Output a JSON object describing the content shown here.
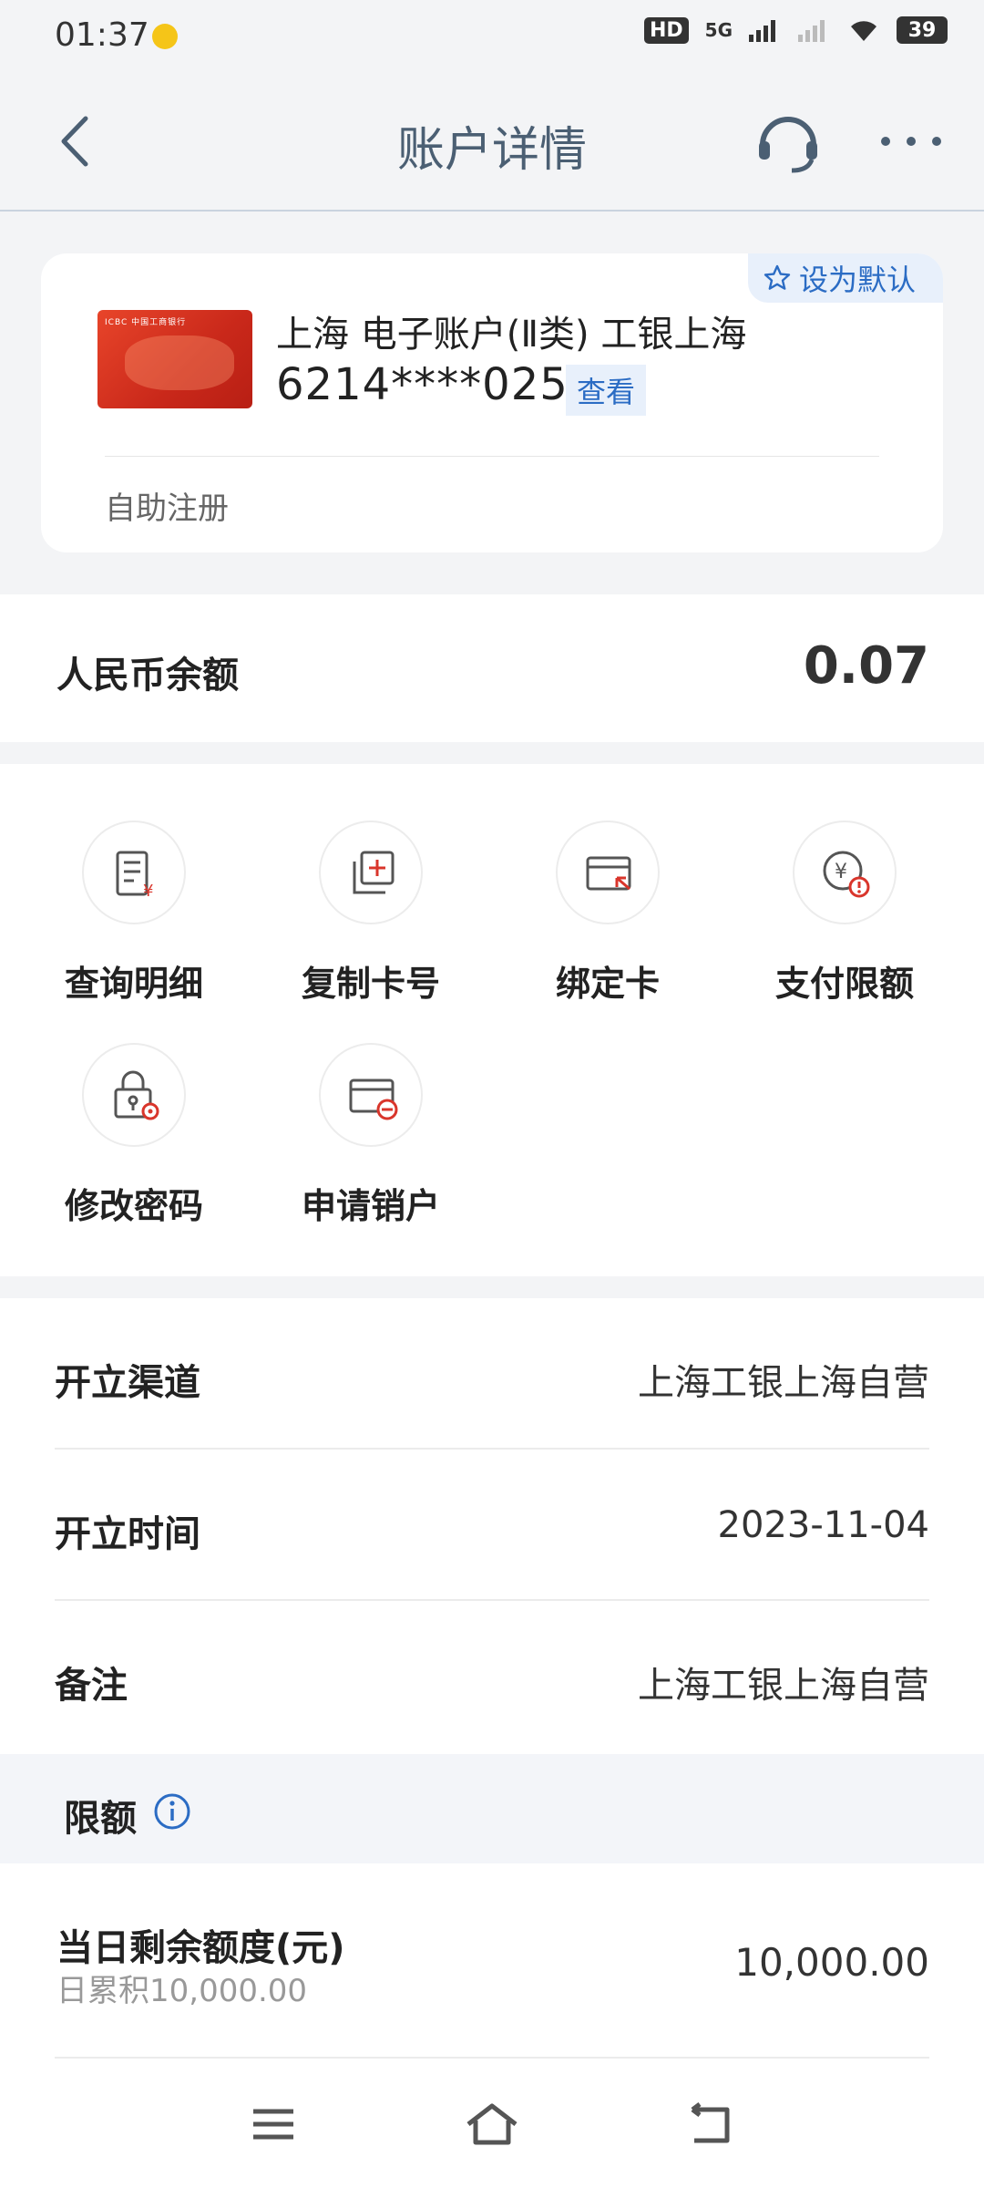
{
  "status_bar": {
    "time": "01:37",
    "network_badge": "HD",
    "network_type": "5G",
    "battery": "39"
  },
  "nav": {
    "title": "账户详情"
  },
  "account_card": {
    "default_label": "设为默认",
    "name": "上海 电子账户(Ⅱ类) 工银上海",
    "number": "6214****0251",
    "view_label": "查看",
    "source": "自助注册",
    "card_brand": "ICBC 中国工商银行"
  },
  "balance": {
    "label": "人民币余额",
    "value": "0.07"
  },
  "actions": [
    {
      "label": "查询明细",
      "icon": "transaction-detail-icon"
    },
    {
      "label": "复制卡号",
      "icon": "copy-card-icon"
    },
    {
      "label": "绑定卡",
      "icon": "bind-card-icon"
    },
    {
      "label": "支付限额",
      "icon": "payment-limit-icon"
    },
    {
      "label": "修改密码",
      "icon": "change-password-icon"
    },
    {
      "label": "申请销户",
      "icon": "close-account-icon"
    }
  ],
  "info": {
    "rows": [
      {
        "label": "开立渠道",
        "value": "上海工银上海自营"
      },
      {
        "label": "开立时间",
        "value": "2023-11-04"
      },
      {
        "label": "备注",
        "value": "上海工银上海自营"
      }
    ]
  },
  "limits": {
    "title": "限额",
    "daily": {
      "label": "当日剩余额度(元)",
      "sub": "日累积10,000.00",
      "value": "10,000.00"
    }
  },
  "colors": {
    "accent": "#2b6cc4",
    "danger": "#d9352b",
    "background": "#f3f4f6"
  }
}
